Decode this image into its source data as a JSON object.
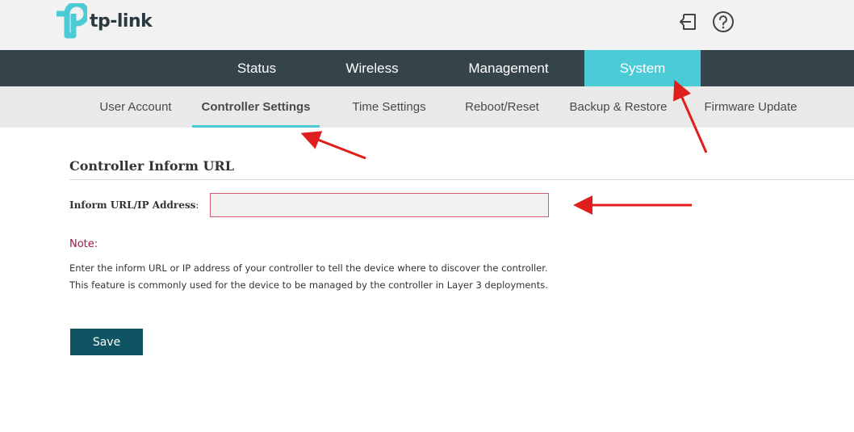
{
  "brand": {
    "logo_text": "tp-link",
    "accent": "#4acbd6",
    "nav_bg": "#35434a",
    "button_bg": "#0f5462",
    "annotation_color": "#e01e1e"
  },
  "header": {
    "icons": [
      "logout-icon",
      "help-icon"
    ]
  },
  "main_nav": {
    "tabs": [
      {
        "label": "Status",
        "active": false
      },
      {
        "label": "Wireless",
        "active": false
      },
      {
        "label": "Management",
        "active": false
      },
      {
        "label": "System",
        "active": true
      }
    ]
  },
  "sub_nav": {
    "items": [
      {
        "label": "User Account",
        "active": false
      },
      {
        "label": "Controller Settings",
        "active": true
      },
      {
        "label": "Time Settings",
        "active": false
      },
      {
        "label": "Reboot/Reset",
        "active": false
      },
      {
        "label": "Backup & Restore",
        "active": false
      },
      {
        "label": "Firmware Update",
        "active": false
      }
    ]
  },
  "content": {
    "section_title": "Controller Inform URL",
    "field_label": "Inform URL/IP Address",
    "field_colon": ":",
    "field_value": "",
    "note_title": "Note:",
    "note_lines": [
      "Enter the inform URL or IP address of your controller to tell the device where to discover the controller.",
      "This feature is commonly used for the device to be managed by the controller in Layer 3 deployments."
    ],
    "save_label": "Save"
  }
}
